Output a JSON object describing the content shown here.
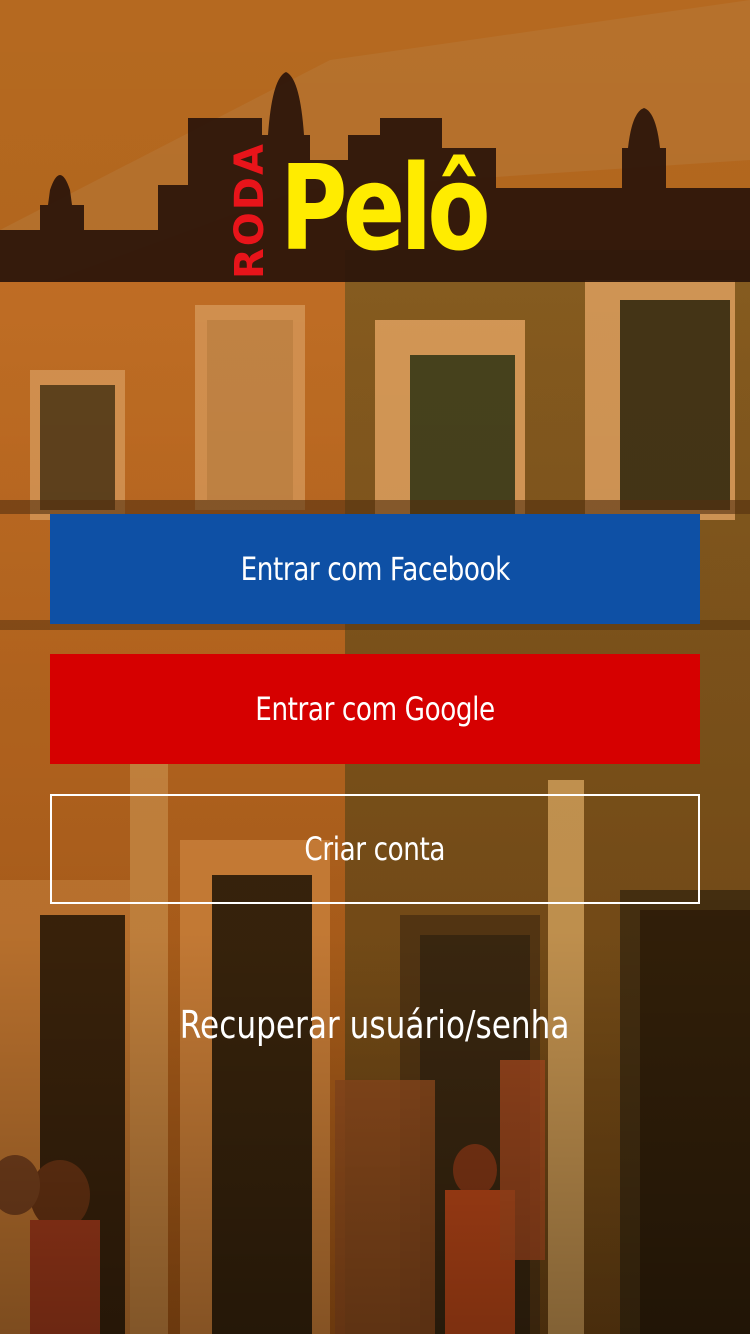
{
  "logo": {
    "small": "RODA",
    "big": "Pelô"
  },
  "buttons": {
    "facebook": "Entrar com Facebook",
    "google": "Entrar com Google",
    "create_account": "Criar conta"
  },
  "links": {
    "recover": "Recuperar usuário/senha"
  },
  "colors": {
    "facebook": "#0e50a5",
    "google": "#d60000",
    "logo_yellow": "#ffec00",
    "logo_red": "#e8141a",
    "header_dark": "#2a140a"
  }
}
